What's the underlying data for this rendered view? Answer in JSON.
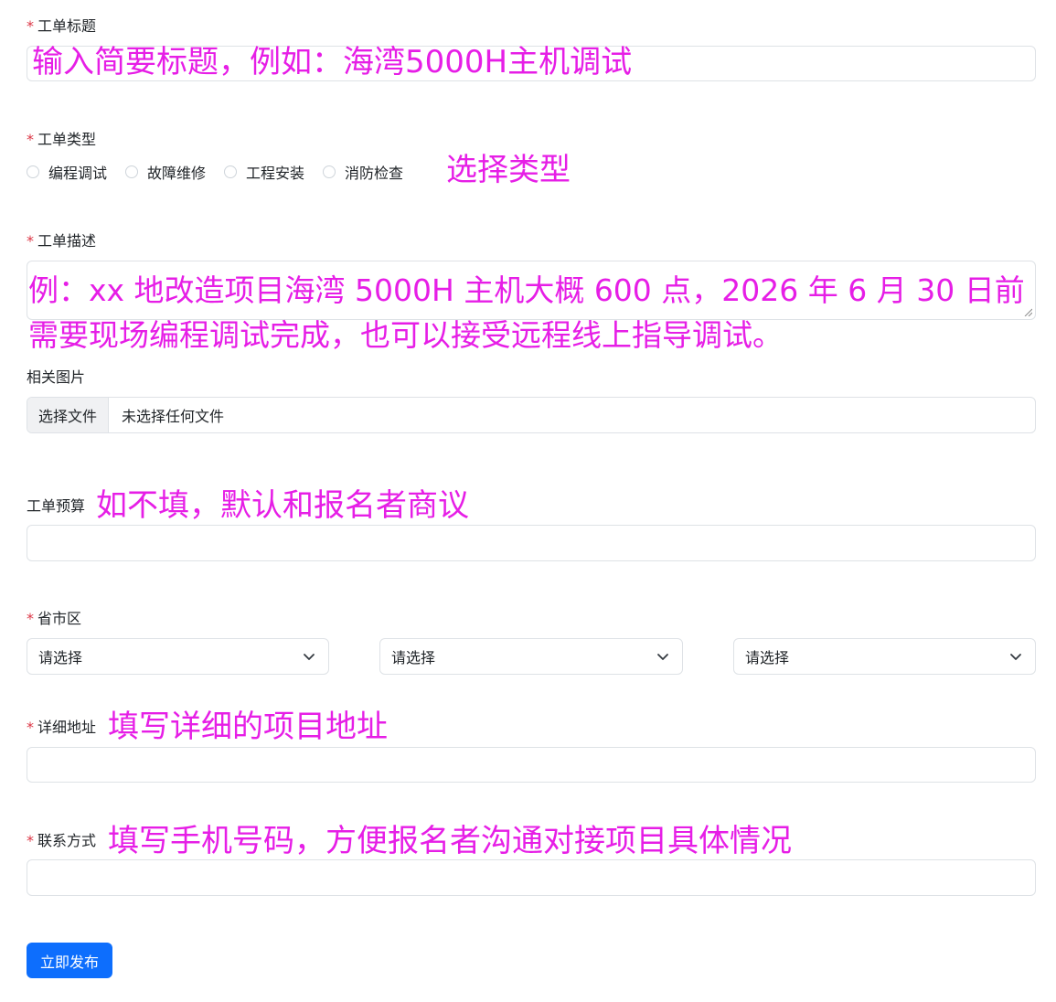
{
  "form": {
    "title": {
      "required": "*",
      "label": "工单标题",
      "annotation": "输入简要标题，例如：海湾5000H主机调试"
    },
    "type": {
      "required": "*",
      "label": "工单类型",
      "options": [
        "编程调试",
        "故障维修",
        "工程安装",
        "消防检查"
      ],
      "annotation": "选择类型"
    },
    "description": {
      "required": "*",
      "label": "工单描述",
      "annotation_line1": "例：xx 地改造项目海湾 5000H 主机大概 600 点，2026 年 6 月 30 日前",
      "annotation_line2": "需要现场编程调试完成，也可以接受远程线上指导调试。"
    },
    "images": {
      "label": "相关图片",
      "button_label": "选择文件",
      "status_text": "未选择任何文件"
    },
    "budget": {
      "label": "工单预算",
      "annotation": "如不填，默认和报名者商议"
    },
    "region": {
      "required": "*",
      "label": "省市区",
      "province_placeholder": "请选择",
      "city_placeholder": "请选择",
      "district_placeholder": "请选择"
    },
    "address": {
      "required": "*",
      "label": "详细地址",
      "annotation": "填写详细的项目地址"
    },
    "contact": {
      "required": "*",
      "label": "联系方式",
      "annotation": "填写手机号码，方便报名者沟通对接项目具体情况"
    },
    "submit_label": "立即发布"
  },
  "colors": {
    "accent": "#0d6efd",
    "required": "#dc3545",
    "annotation": "#e61ee6",
    "border": "#dee2e6"
  }
}
